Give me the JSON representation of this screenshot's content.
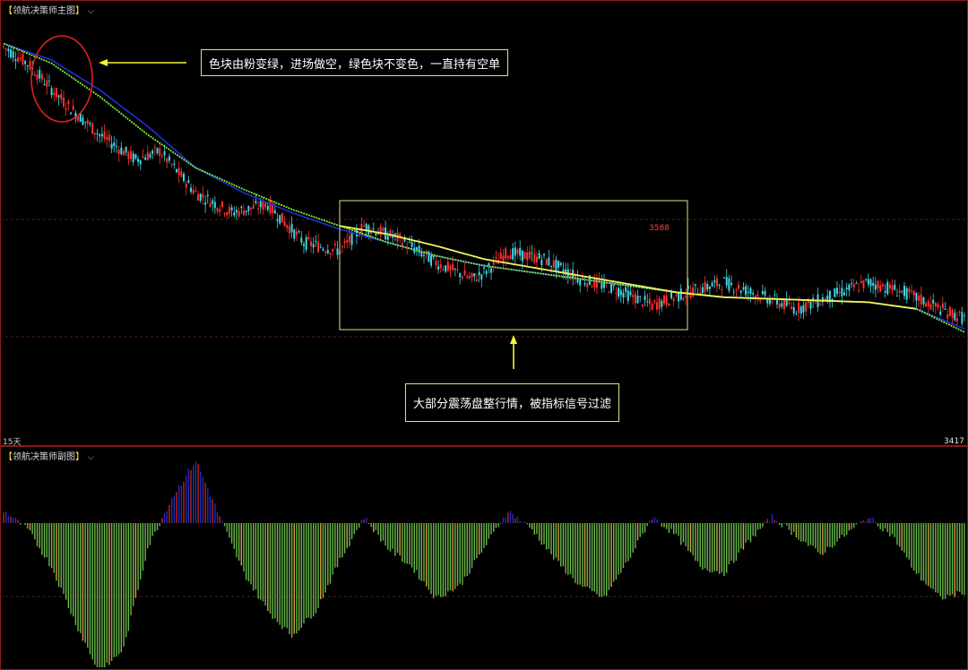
{
  "main_panel": {
    "title": "领航决策师主图",
    "period_label": "15天",
    "high_label": "3588",
    "low_label": "3417"
  },
  "sub_panel": {
    "title": "领航决策师副图"
  },
  "annotations": {
    "top_note": "色块由粉变绿，进场做空，绿色块不变色，一直持有空单",
    "bottom_note": "大部分震荡盘整行情，被指标信号过滤"
  },
  "colors": {
    "background": "#000000",
    "candle_up": "#ff3030",
    "candle_down": "#3fd6e6",
    "ma_blue": "#1e2fd8",
    "ma_green": "#7cf03c",
    "ma_yellow": "#f2f25a",
    "hist_positive_red": "#c81e1e",
    "hist_positive_blue": "#1e2fb8",
    "hist_negative": "#6ab84a",
    "panel_border": "#8b1a1a",
    "note_border": "#e6e07a",
    "ellipse": "#e02020",
    "arrow": "#f4f43a"
  },
  "chart_data": [
    {
      "type": "candlestick",
      "panel": "main",
      "xlabel": "",
      "ylabel": "",
      "grid": "dashed horizontal",
      "annotated_values": {
        "high": 3588,
        "low": 3417
      },
      "price_range": [
        3417,
        3660
      ],
      "close_path": [
        [
          0,
          3648
        ],
        [
          10,
          3638
        ],
        [
          25,
          3615
        ],
        [
          40,
          3595
        ],
        [
          55,
          3580
        ],
        [
          65,
          3585
        ],
        [
          80,
          3560
        ],
        [
          95,
          3548
        ],
        [
          110,
          3553
        ],
        [
          125,
          3530
        ],
        [
          140,
          3525
        ],
        [
          150,
          3540
        ],
        [
          165,
          3532
        ],
        [
          180,
          3518
        ],
        [
          195,
          3508
        ],
        [
          200,
          3512
        ],
        [
          210,
          3524
        ],
        [
          225,
          3520
        ],
        [
          240,
          3508
        ],
        [
          255,
          3502
        ],
        [
          270,
          3492
        ],
        [
          285,
          3500
        ],
        [
          300,
          3506
        ],
        [
          315,
          3498
        ],
        [
          330,
          3490
        ],
        [
          345,
          3498
        ],
        [
          360,
          3506
        ],
        [
          375,
          3500
        ],
        [
          390,
          3490
        ],
        [
          400,
          3484
        ]
      ],
      "lines": [
        {
          "color_key": "ma_blue",
          "values": [
            [
              0,
              3650
            ],
            [
              20,
              3640
            ],
            [
              40,
              3622
            ],
            [
              60,
              3600
            ],
            [
              80,
              3575
            ],
            [
              100,
              3560
            ],
            [
              120,
              3548
            ],
            [
              140,
              3538
            ],
            [
              160,
              3530
            ],
            [
              180,
              3522
            ],
            [
              200,
              3516
            ],
            [
              220,
              3512
            ],
            [
              240,
              3508
            ],
            [
              260,
              3504
            ],
            [
              280,
              3500
            ],
            [
              300,
              3497
            ],
            [
              320,
              3496
            ],
            [
              340,
              3495
            ],
            [
              360,
              3494
            ],
            [
              380,
              3490
            ],
            [
              400,
              3478
            ]
          ]
        },
        {
          "color_key": "ma_green",
          "values": [
            [
              0,
              3650
            ],
            [
              20,
              3638
            ],
            [
              40,
              3618
            ],
            [
              60,
              3595
            ],
            [
              80,
              3575
            ],
            [
              100,
              3562
            ],
            [
              120,
              3550
            ],
            [
              140,
              3540
            ],
            [
              160,
              3530
            ],
            [
              180,
              3522
            ],
            [
              200,
              3516
            ],
            [
              220,
              3512
            ],
            [
              240,
              3508
            ],
            [
              260,
              3504
            ],
            [
              280,
              3500
            ],
            [
              300,
              3497
            ],
            [
              320,
              3496
            ],
            [
              340,
              3495
            ],
            [
              360,
              3494
            ],
            [
              380,
              3490
            ],
            [
              400,
              3476
            ]
          ]
        },
        {
          "color_key": "ma_yellow",
          "values": [
            [
              140,
              3540
            ],
            [
              160,
              3535
            ],
            [
              180,
              3528
            ],
            [
              200,
              3520
            ],
            [
              220,
              3515
            ],
            [
              240,
              3510
            ],
            [
              260,
              3505
            ],
            [
              280,
              3500
            ],
            [
              300,
              3497
            ],
            [
              320,
              3496
            ],
            [
              340,
              3495
            ],
            [
              360,
              3494
            ],
            [
              380,
              3490
            ]
          ]
        }
      ]
    },
    {
      "type": "bar",
      "panel": "sub",
      "xlabel": "",
      "ylabel": "",
      "series": [
        {
          "name": "",
          "values": [
            [
              0,
              0.1
            ],
            [
              10,
              -0.05
            ],
            [
              20,
              -0.35
            ],
            [
              30,
              -0.8
            ],
            [
              40,
              -1.2
            ],
            [
              50,
              -1.0
            ],
            [
              60,
              -0.2
            ],
            [
              70,
              0.2
            ],
            [
              80,
              0.5
            ],
            [
              90,
              0.05
            ],
            [
              100,
              -0.4
            ],
            [
              110,
              -0.7
            ],
            [
              120,
              -0.9
            ],
            [
              130,
              -0.7
            ],
            [
              140,
              -0.3
            ],
            [
              150,
              0.05
            ],
            [
              160,
              -0.2
            ],
            [
              170,
              -0.35
            ],
            [
              180,
              -0.6
            ],
            [
              190,
              -0.5
            ],
            [
              200,
              -0.2
            ],
            [
              210,
              0.1
            ],
            [
              220,
              -0.05
            ],
            [
              230,
              -0.3
            ],
            [
              240,
              -0.5
            ],
            [
              250,
              -0.6
            ],
            [
              260,
              -0.3
            ],
            [
              270,
              0.05
            ],
            [
              280,
              -0.1
            ],
            [
              290,
              -0.35
            ],
            [
              300,
              -0.4
            ],
            [
              310,
              -0.15
            ],
            [
              320,
              0.05
            ],
            [
              330,
              -0.1
            ],
            [
              340,
              -0.25
            ],
            [
              350,
              -0.1
            ],
            [
              360,
              0.05
            ],
            [
              370,
              -0.1
            ],
            [
              380,
              -0.4
            ],
            [
              390,
              -0.6
            ],
            [
              400,
              -0.55
            ]
          ]
        }
      ]
    }
  ]
}
